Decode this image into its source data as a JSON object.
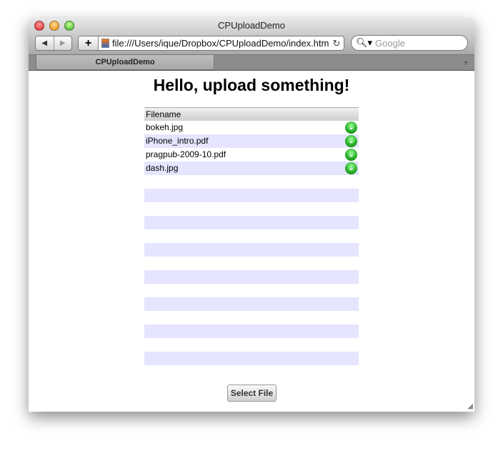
{
  "window": {
    "title": "CPUploadDemo",
    "url": "file:///Users/ique/Dropbox/CPUploadDemo/index.html",
    "search_placeholder": "Google",
    "tab_label": "CPUploadDemo"
  },
  "page": {
    "heading": "Hello, upload something!",
    "column_header": "Filename",
    "select_button": "Select File",
    "files": [
      {
        "name": "bokeh.jpg",
        "status": "download-icon"
      },
      {
        "name": "iPhone_intro.pdf",
        "status": "download-icon"
      },
      {
        "name": "pragpub-2009-10.pdf",
        "status": "download-icon"
      },
      {
        "name": "dash.jpg",
        "status": "download-icon"
      }
    ],
    "empty_rows": 14,
    "colors": {
      "alt_row": "#e5e5ff",
      "accent": "#22aa22"
    }
  }
}
